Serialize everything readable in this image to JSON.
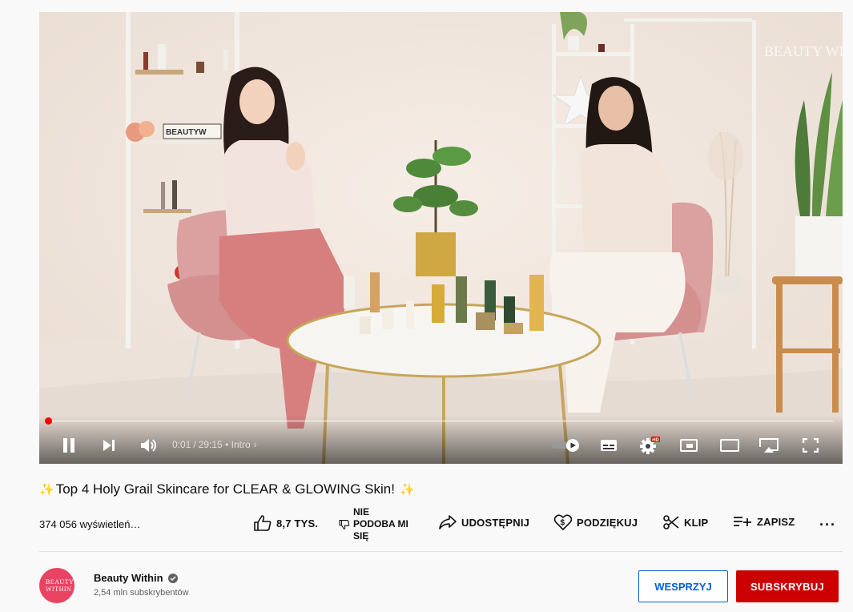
{
  "player": {
    "time_current": "0:01",
    "time_separator": "/",
    "time_total": "29:15",
    "chapter": "• Intro",
    "chapter_arrow": "›",
    "progress_fraction": 0.0006,
    "hd_badge": "HD",
    "shelf_sign": "BEAUTYW",
    "watermark": "BEAUTY WITHIN"
  },
  "video": {
    "title": "Top 4 Holy Grail Skincare for CLEAR & GLOWING Skin!",
    "title_emoji": "✨",
    "views": "374 056 wyświetleń…"
  },
  "actions": {
    "like_count": "8,7 TYS.",
    "dislike_label": "NIE PODOBA MI SIĘ",
    "share_label": "UDOSTĘPNIJ",
    "thanks_label": "PODZIĘKUJ",
    "clip_label": "KLIP",
    "save_label": "ZAPISZ",
    "more_label": "···"
  },
  "channel": {
    "name": "Beauty Within",
    "subscribers": "2,54 mln subskrybentów",
    "avatar_text": "BEAUTY WITHIN",
    "support_button": "WESPRZYJ",
    "subscribe_button": "SUBSKRYBUJ"
  },
  "colors": {
    "accent_red": "#cc0000",
    "link_blue": "#065fd4",
    "avatar_pink": "#e84363"
  },
  "icons": [
    "pause-icon",
    "next-icon",
    "volume-icon",
    "autoplay-toggle-icon",
    "subtitles-icon",
    "settings-icon",
    "miniplayer-icon",
    "theater-icon",
    "cast-icon",
    "fullscreen-icon",
    "like-icon",
    "dislike-icon",
    "share-icon",
    "thanks-icon",
    "clip-icon",
    "save-icon",
    "verified-icon"
  ]
}
